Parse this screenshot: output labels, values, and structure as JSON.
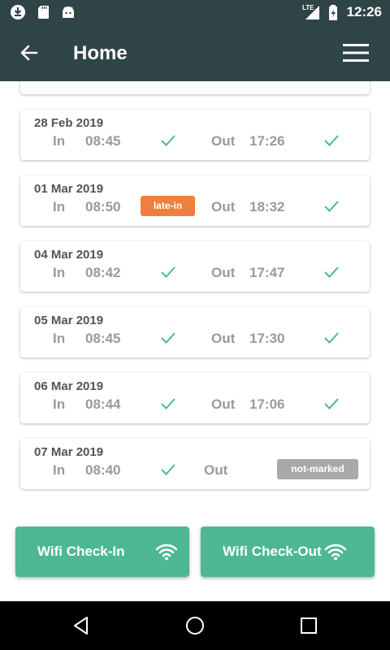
{
  "status_bar": {
    "time": "12:26",
    "network_label": "LTE",
    "icons": [
      "download-icon",
      "sd-card-icon",
      "android-icon",
      "signal-icon",
      "battery-charging-icon"
    ]
  },
  "app_bar": {
    "title": "Home",
    "back_icon": "arrow-left-icon",
    "menu_icon": "hamburger-menu-icon",
    "color": "#2f4447"
  },
  "attendance": [
    {
      "date": "28 Feb 2019",
      "in_label": "In",
      "in_time": "08:45",
      "in_status": "check",
      "out_label": "Out",
      "out_time": "17:26",
      "out_status": "check"
    },
    {
      "date": "01 Mar 2019",
      "in_label": "In",
      "in_time": "08:50",
      "in_status": "late-in",
      "out_label": "Out",
      "out_time": "18:32",
      "out_status": "check"
    },
    {
      "date": "04 Mar 2019",
      "in_label": "In",
      "in_time": "08:42",
      "in_status": "check",
      "out_label": "Out",
      "out_time": "17:47",
      "out_status": "check"
    },
    {
      "date": "05 Mar 2019",
      "in_label": "In",
      "in_time": "08:45",
      "in_status": "check",
      "out_label": "Out",
      "out_time": "17:30",
      "out_status": "check"
    },
    {
      "date": "06 Mar 2019",
      "in_label": "In",
      "in_time": "08:44",
      "in_status": "check",
      "out_label": "Out",
      "out_time": "17:06",
      "out_status": "check"
    },
    {
      "date": "07 Mar 2019",
      "in_label": "In",
      "in_time": "08:40",
      "in_status": "check",
      "out_label": "Out",
      "out_time": "",
      "out_status": "not-marked"
    }
  ],
  "badges": {
    "late_in": "late-in",
    "not_marked": "not-marked",
    "late_color": "#ef7e3f",
    "not_marked_color": "#a9a9a9"
  },
  "check_color": "#4db891",
  "actions": {
    "checkin_label": "Wifi Check-In",
    "checkout_label": "Wifi Check-Out",
    "icon": "wifi-icon",
    "color": "#4db891"
  },
  "nav_bar": {
    "icons": [
      "back-triangle-icon",
      "home-circle-icon",
      "recents-square-icon"
    ]
  }
}
